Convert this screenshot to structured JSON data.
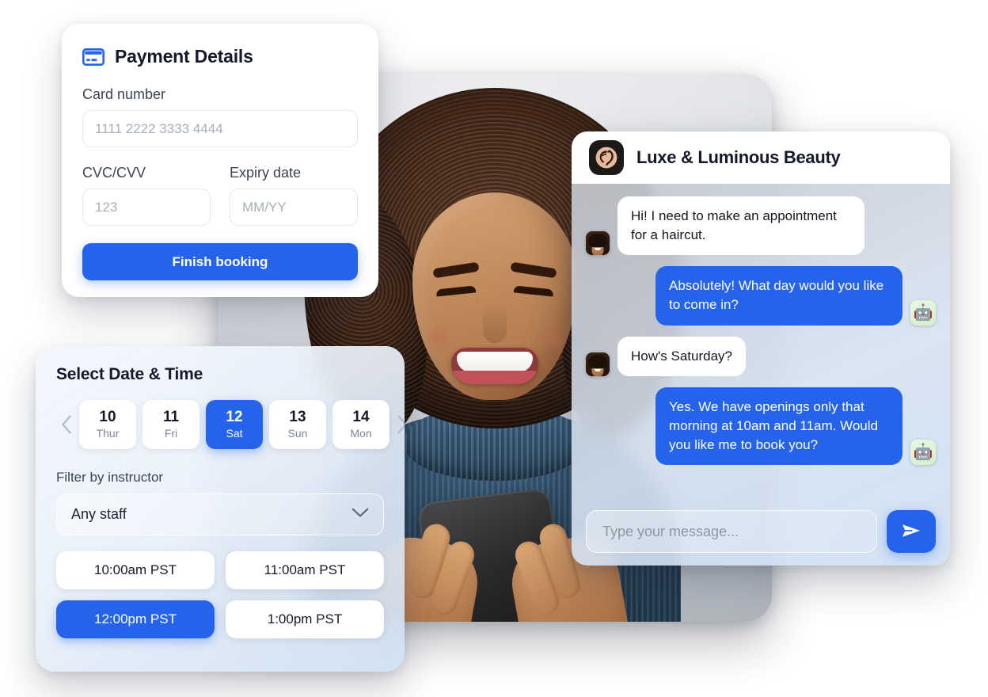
{
  "payment": {
    "icon": "credit-card-icon",
    "title": "Payment Details",
    "card_number_label": "Card number",
    "card_number_placeholder": "1111 2222 3333 4444",
    "card_number_value": "",
    "cvc_label": "CVC/CVV",
    "cvc_placeholder": "123",
    "cvc_value": "",
    "expiry_label": "Expiry date",
    "expiry_placeholder": "MM/YY",
    "expiry_value": "",
    "submit_label": "Finish booking"
  },
  "datetime": {
    "title": "Select Date & Time",
    "prev_icon": "chevron-left-icon",
    "next_icon": "chevron-right-icon",
    "dates": [
      {
        "day": "10",
        "dow": "Thur",
        "selected": false
      },
      {
        "day": "11",
        "dow": "Fri",
        "selected": false
      },
      {
        "day": "12",
        "dow": "Sat",
        "selected": true
      },
      {
        "day": "13",
        "dow": "Sun",
        "selected": false
      },
      {
        "day": "14",
        "dow": "Mon",
        "selected": false
      }
    ],
    "filter_label": "Filter by instructor",
    "filter_value": "Any staff",
    "filter_chevron_icon": "chevron-down-icon",
    "slots": [
      {
        "label": "10:00am PST",
        "selected": false
      },
      {
        "label": "11:00am PST",
        "selected": false
      },
      {
        "label": "12:00pm PST",
        "selected": true
      },
      {
        "label": "1:00pm PST",
        "selected": false
      }
    ]
  },
  "chat": {
    "brand": "Luxe & Luminous Beauty",
    "logo_icon": "salon-woman-profile-logo",
    "messages": [
      {
        "from": "user",
        "text": "Hi! I need to make an appointment for a haircut."
      },
      {
        "from": "bot",
        "text": "Absolutely! What day would you like to come in?"
      },
      {
        "from": "user",
        "text": "How's Saturday?"
      },
      {
        "from": "bot",
        "text": "Yes. We have openings only that morning at 10am and 11am. Would you like me to book you?"
      }
    ],
    "bot_avatar_glyph": "🤖",
    "input_placeholder": "Type your message...",
    "input_value": "",
    "send_icon": "send-paper-plane-icon"
  },
  "photo": {
    "alt": "smiling woman with curly hair holding a smartphone"
  },
  "colors": {
    "accent_blue": "#2563EB",
    "text_dark": "#16182B",
    "muted_text": "#7C8698",
    "panel_white": "#FFFFFF",
    "logo_dark": "#1C1917",
    "logo_peach": "#E8B89B"
  }
}
